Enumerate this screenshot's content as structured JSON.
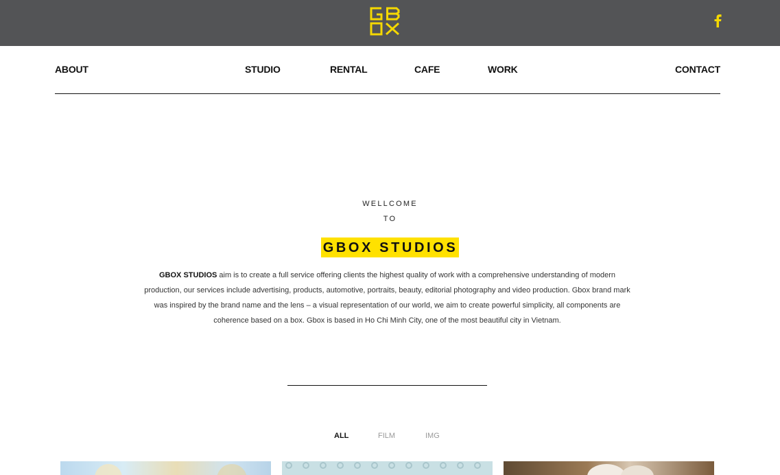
{
  "header": {
    "logo_text": "GBOX",
    "brand_color": "#f5d800",
    "bar_color": "#535456",
    "social_icon": "facebook-icon"
  },
  "nav": {
    "about": "ABOUT",
    "studio": "STUDIO",
    "rental": "RENTAL",
    "cafe": "CAFE",
    "work": "WORK",
    "contact": "CONTACT"
  },
  "intro": {
    "line1": "WELLCOME",
    "line2": "TO",
    "title": "GBOX STUDIOS",
    "highlight_color": "#ffe100",
    "desc_bold": "GBOX STUDIOS",
    "desc_rest": " aim is to create a full service offering clients the highest quality of work with a comprehensive understanding of modern production, our services include advertising, products, automotive, portraits, beauty, editorial photography and video production. Gbox brand mark was inspired by the brand name and the lens – a visual representation of our world, we aim to create powerful simplicity, all components are coherence based on a box. Gbox is based in Ho Chi Minh City, one of the most beautiful city in Vietnam."
  },
  "filters": {
    "all": "ALL",
    "film": "FILM",
    "img": "IMG",
    "active": "ALL"
  },
  "gallery": {
    "items": [
      {
        "name": "thumbnail-1"
      },
      {
        "name": "thumbnail-2"
      },
      {
        "name": "thumbnail-3"
      }
    ]
  }
}
